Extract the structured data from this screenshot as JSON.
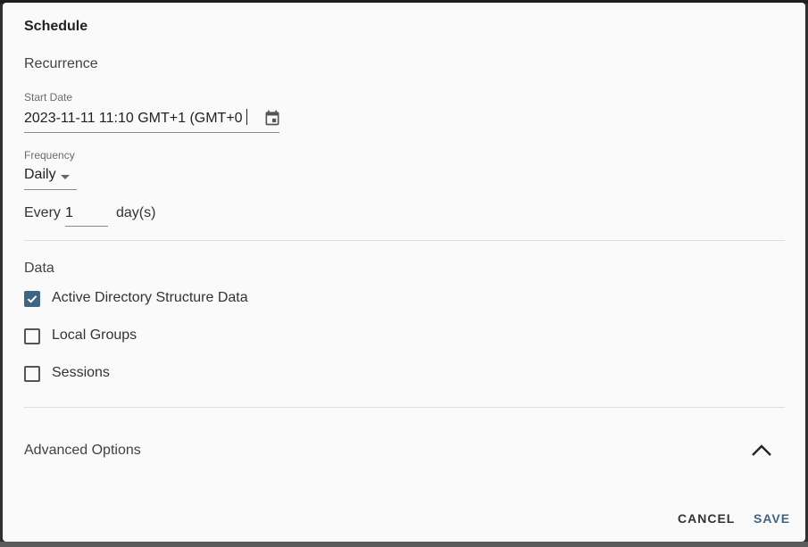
{
  "dialog": {
    "title": "Schedule"
  },
  "recurrence": {
    "heading": "Recurrence",
    "start_date": {
      "label": "Start Date",
      "value": "2023-11-11 11:10 GMT+1 (GMT+0",
      "icon": "calendar-icon"
    },
    "frequency": {
      "label": "Frequency",
      "selected": "Daily",
      "icon": "dropdown-arrow-icon"
    },
    "every": {
      "prefix": "Every",
      "value": "1",
      "unit": "day(s)"
    }
  },
  "data_section": {
    "heading": "Data",
    "options": [
      {
        "label": "Active Directory Structure Data",
        "checked": true
      },
      {
        "label": "Local Groups",
        "checked": false
      },
      {
        "label": "Sessions",
        "checked": false
      }
    ]
  },
  "advanced": {
    "label": "Advanced Options",
    "expanded": true,
    "icon": "chevron-up-icon"
  },
  "actions": {
    "cancel_label": "CANCEL",
    "save_label": "SAVE"
  },
  "colors": {
    "accent": "#3f6584",
    "surface": "#fafafa",
    "divider": "#dedede"
  }
}
